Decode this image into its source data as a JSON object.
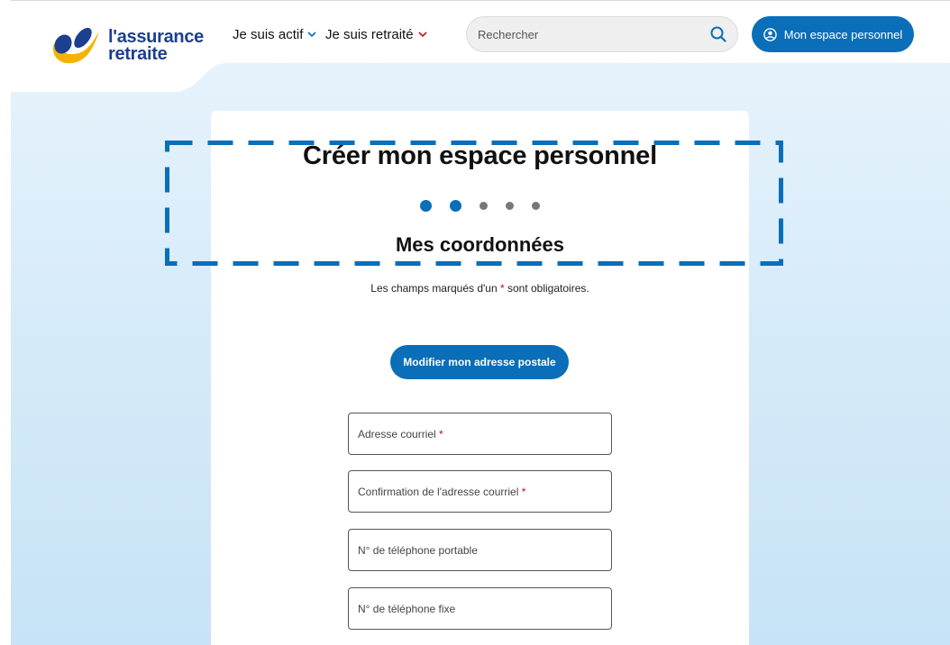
{
  "header": {
    "logo_line1": "l'assurance",
    "logo_line2": "retraite",
    "nav": [
      {
        "label": "Je suis actif"
      },
      {
        "label": "Je suis retraité"
      }
    ],
    "search_placeholder": "Rechercher",
    "account_button": "Mon espace personnel"
  },
  "main": {
    "title": "Créer mon espace personnel",
    "steps": {
      "total": 5,
      "current": 2
    },
    "subtitle": "Mes coordonnées",
    "required_note_prefix": "Les champs marqués d'un ",
    "required_star": "*",
    "required_note_suffix": " sont obligatoires.",
    "modify_button": "Modifier mon adresse postale",
    "fields": [
      {
        "label": "Adresse courriel",
        "required": "*"
      },
      {
        "label": "Confirmation de l'adresse courriel",
        "required": "*"
      },
      {
        "label": "N° de téléphone portable"
      },
      {
        "label": "N° de téléphone fixe"
      }
    ]
  },
  "colors": {
    "primary": "#0a6eb9",
    "required": "#d0021b",
    "logo_blue": "#1c3f8f",
    "logo_yellow": "#f5b300",
    "nav_chevron_actif": "#0a6eb9",
    "nav_chevron_retraite": "#c8102e",
    "annotation": "#0a6eb9"
  },
  "icons": {
    "search": "search-icon",
    "account": "user-circle-icon",
    "chevron": "chevron-down-icon"
  }
}
